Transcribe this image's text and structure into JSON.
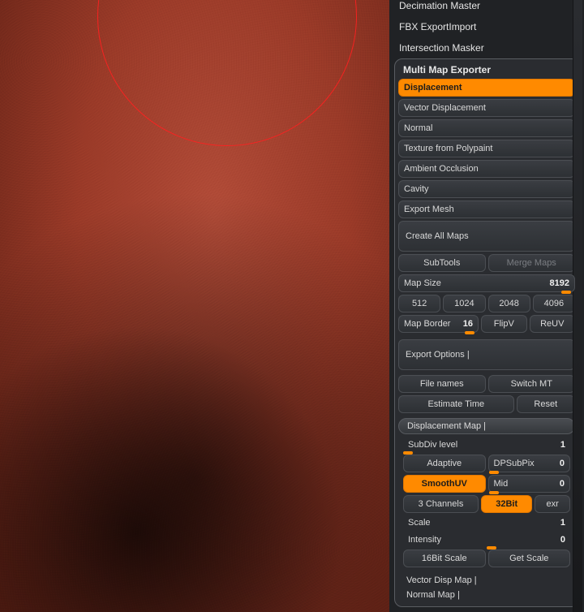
{
  "plugins": {
    "items": [
      "Decimation Master",
      "FBX ExportImport",
      "Intersection Masker",
      "Multi Map Exporter"
    ]
  },
  "mme": {
    "maps": {
      "displacement": "Displacement",
      "vector_displacement": "Vector Displacement",
      "normal": "Normal",
      "texture_polypaint": "Texture from Polypaint",
      "ambient_occlusion": "Ambient Occlusion",
      "cavity": "Cavity",
      "export_mesh": "Export Mesh"
    },
    "create_all": "Create All Maps",
    "subtools": "SubTools",
    "merge_maps": "Merge Maps",
    "map_size": {
      "label": "Map Size",
      "value": "8192"
    },
    "sizes": [
      "512",
      "1024",
      "2048",
      "4096"
    ],
    "map_border": {
      "label": "Map Border",
      "value": "16"
    },
    "flipv": "FlipV",
    "reuv": "ReUV",
    "export_options": "Export Options",
    "file_names": "File names",
    "switch_mt": "Switch MT",
    "estimate_time": "Estimate Time",
    "reset": "Reset",
    "disp_header": "Displacement Map",
    "subdiv": {
      "label": "SubDiv level",
      "value": "1"
    },
    "adaptive": "Adaptive",
    "dpsubpix": {
      "label": "DPSubPix",
      "value": "0"
    },
    "smoothuv": "SmoothUV",
    "mid": {
      "label": "Mid",
      "value": "0"
    },
    "three_channels": "3 Channels",
    "bit32": "32Bit",
    "exr": "exr",
    "scale": {
      "label": "Scale",
      "value": "1"
    },
    "intensity": {
      "label": "Intensity",
      "value": "0"
    },
    "bit16scale": "16Bit Scale",
    "get_scale": "Get Scale",
    "vector_header": "Vector Disp Map",
    "normal_header": "Normal Map"
  }
}
